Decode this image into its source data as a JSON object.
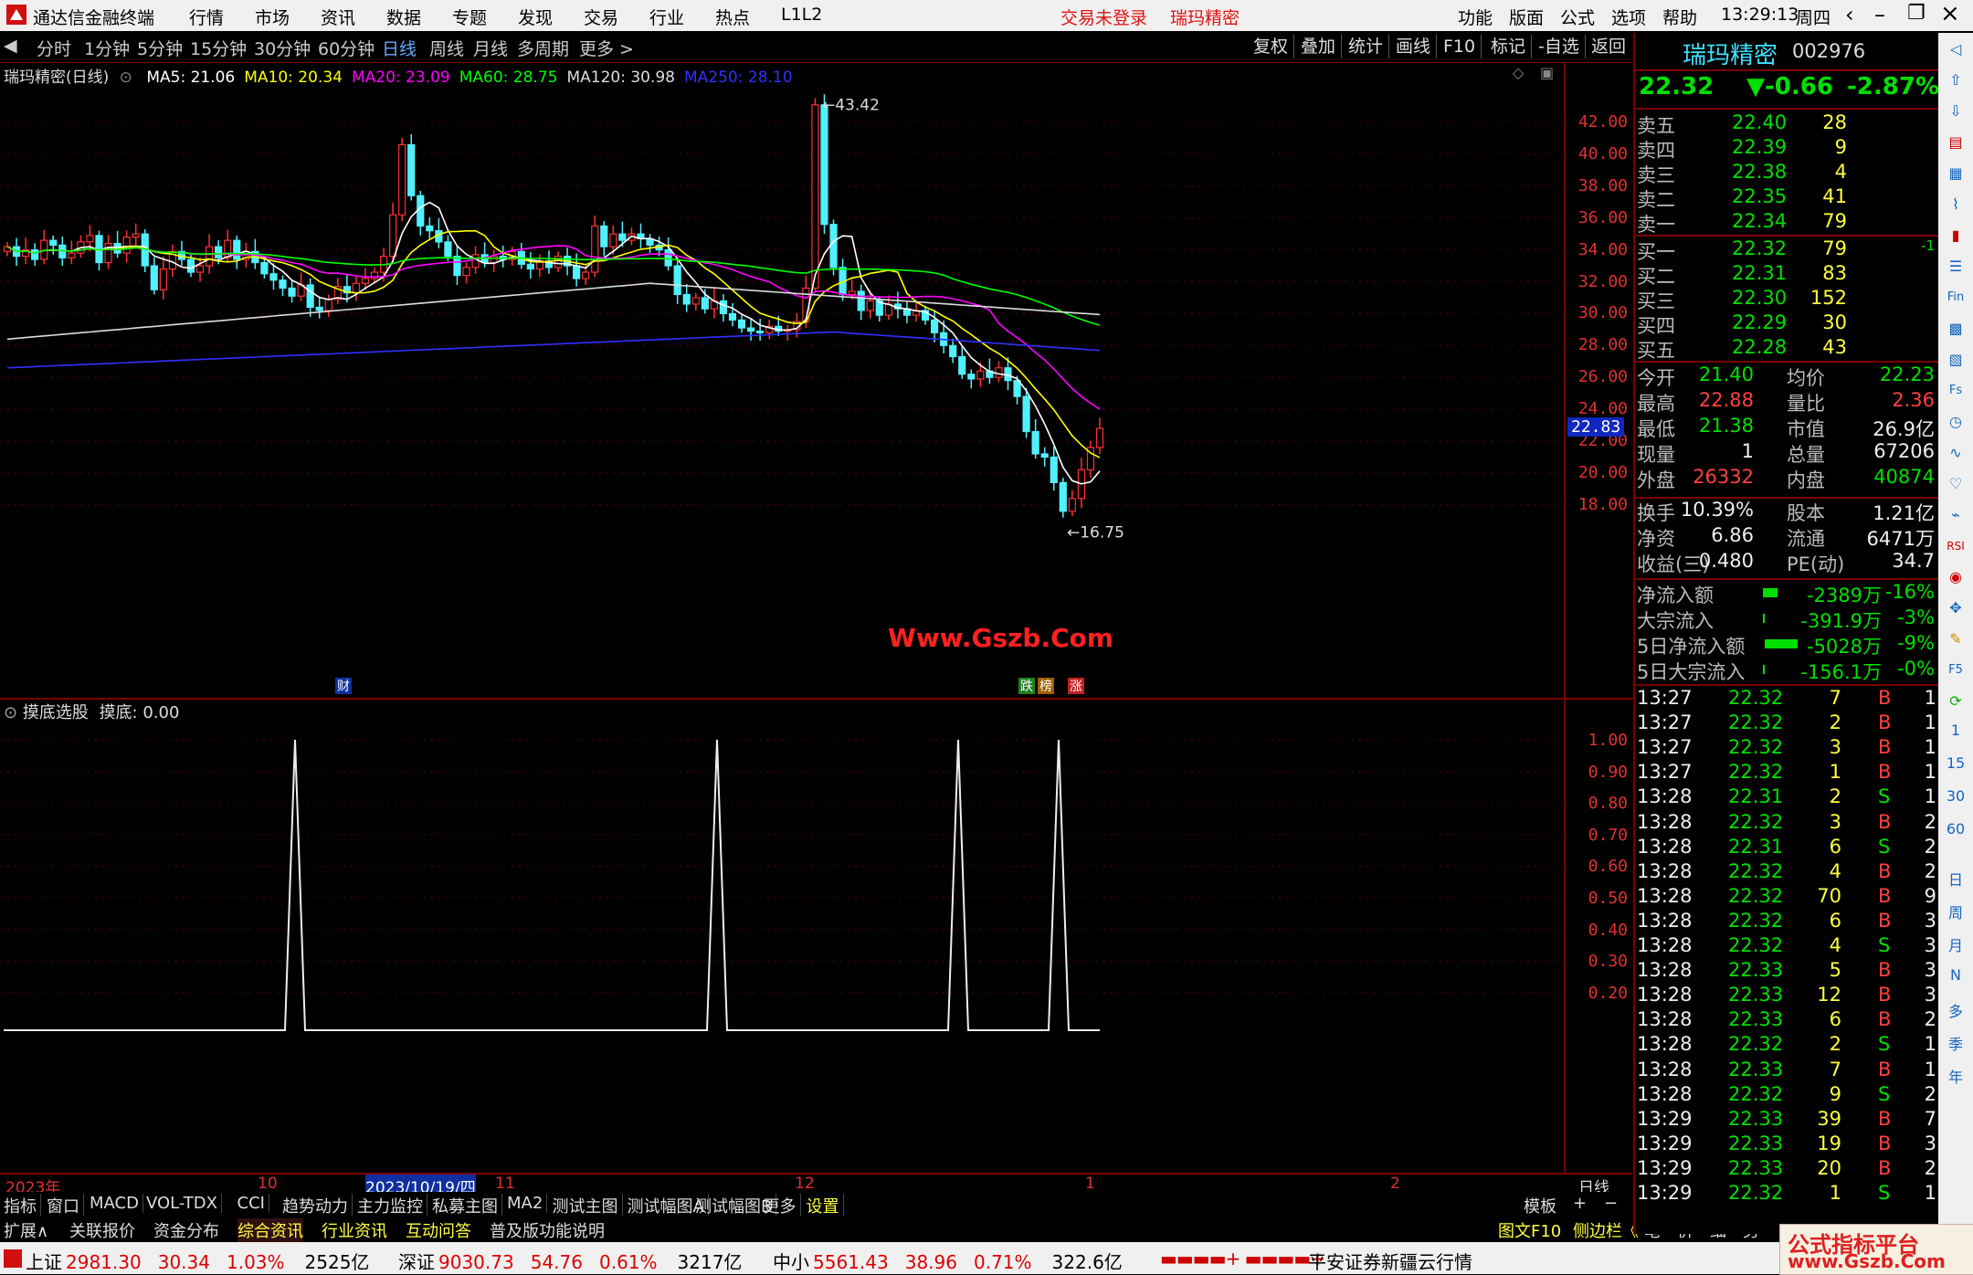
{
  "titlebar": {
    "app_name": "通达信金融终端",
    "menu": [
      "行情",
      "市场",
      "资讯",
      "数据",
      "专题",
      "发现",
      "交易",
      "行业",
      "热点",
      "L1L2"
    ],
    "login_status": "交易未登录",
    "stock_name": "瑞玛精密",
    "right_menu": [
      "功能",
      "版面",
      "公式",
      "选项",
      "帮助"
    ],
    "time": "13:29:13",
    "weekday": "周四"
  },
  "periods": [
    "分时",
    "1分钟",
    "5分钟",
    "15分钟",
    "30分钟",
    "60分钟",
    "日线",
    "周线",
    "月线",
    "多周期",
    "更多 >"
  ],
  "active_period": "日线",
  "chart_tools": [
    "复权",
    "叠加",
    "统计",
    "画线",
    "F10",
    "标记",
    "-自选",
    "返回"
  ],
  "main_chart": {
    "title": "瑞玛精密(日线)",
    "ma_labels": [
      {
        "text": "MA5: 21.06",
        "color": "#ffffff"
      },
      {
        "text": "MA10: 20.34",
        "color": "#ffff00"
      },
      {
        "text": "MA20: 23.09",
        "color": "#ff00ff"
      },
      {
        "text": "MA60: 28.75",
        "color": "#00ff00"
      },
      {
        "text": "MA120: 30.98",
        "color": "#dddddd"
      },
      {
        "text": "MA250: 28.10",
        "color": "#3030ff"
      }
    ],
    "y_ticks": [
      "42.00",
      "40.00",
      "38.00",
      "36.00",
      "34.00",
      "32.00",
      "30.00",
      "28.00",
      "26.00",
      "24.00",
      "22.00",
      "20.00",
      "18.00"
    ],
    "current_price_tag": "22.83",
    "high_label": "43.42",
    "low_label": "16.75",
    "watermark": "Www.Gszb.Com",
    "markers": [
      "财",
      "跌",
      "榜",
      "涨"
    ]
  },
  "indicator": {
    "name": "摸底选股",
    "value_label": "摸底: 0.00",
    "y_ticks": [
      "1.00",
      "0.90",
      "0.80",
      "0.70",
      "0.60",
      "0.50",
      "0.40",
      "0.30",
      "0.20"
    ]
  },
  "x_axis": {
    "labels": [
      "2023年",
      "10",
      "2023/10/19/四",
      "11",
      "12",
      "1",
      "2"
    ],
    "period": "日线"
  },
  "quote": {
    "name": "瑞玛精密",
    "code": "002976",
    "price": "22.32",
    "change": "▼-0.66",
    "pct": "-2.87%",
    "asks": [
      {
        "label": "卖五",
        "price": "22.40",
        "vol": "28"
      },
      {
        "label": "卖四",
        "price": "22.39",
        "vol": "9"
      },
      {
        "label": "卖三",
        "price": "22.38",
        "vol": "4"
      },
      {
        "label": "卖二",
        "price": "22.35",
        "vol": "41"
      },
      {
        "label": "卖一",
        "price": "22.34",
        "vol": "79"
      }
    ],
    "bids": [
      {
        "label": "买一",
        "price": "22.32",
        "vol": "79",
        "extra": "-1"
      },
      {
        "label": "买二",
        "price": "22.31",
        "vol": "83",
        "extra": ""
      },
      {
        "label": "买三",
        "price": "22.30",
        "vol": "152",
        "extra": ""
      },
      {
        "label": "买四",
        "price": "22.29",
        "vol": "30",
        "extra": ""
      },
      {
        "label": "买五",
        "price": "22.28",
        "vol": "43",
        "extra": ""
      }
    ],
    "stats": [
      {
        "l1": "今开",
        "v1": "21.40",
        "l2": "均价",
        "v2": "22.23"
      },
      {
        "l1": "最高",
        "v1": "22.88",
        "l2": "量比",
        "v2": "2.36"
      },
      {
        "l1": "最低",
        "v1": "21.38",
        "l2": "市值",
        "v2": "26.9亿"
      },
      {
        "l1": "现量",
        "v1": "1",
        "l2": "总量",
        "v2": "67206"
      },
      {
        "l1": "外盘",
        "v1": "26332",
        "l2": "内盘",
        "v2": "40874"
      }
    ],
    "stats2": [
      {
        "l1": "换手",
        "v1": "10.39%",
        "l2": "股本",
        "v2": "1.21亿"
      },
      {
        "l1": "净资",
        "v1": "6.86",
        "l2": "流通",
        "v2": "6471万"
      },
      {
        "l1": "收益(三)",
        "v1": "0.480",
        "l2": "PE(动)",
        "v2": "34.7"
      }
    ],
    "flows": [
      {
        "label": "净流入额",
        "value": "-2389万",
        "pct": "-16%"
      },
      {
        "label": "大宗流入",
        "value": "-391.9万",
        "pct": "-3%"
      },
      {
        "label": "5日净流入额",
        "value": "-5028万",
        "pct": "-9%"
      },
      {
        "label": "5日大宗流入",
        "value": "-156.1万",
        "pct": "-0%"
      }
    ],
    "ticks": [
      {
        "t": "13:27",
        "p": "22.32",
        "v": "7",
        "s": "B",
        "n": "1"
      },
      {
        "t": "13:27",
        "p": "22.32",
        "v": "2",
        "s": "B",
        "n": "1"
      },
      {
        "t": "13:27",
        "p": "22.32",
        "v": "3",
        "s": "B",
        "n": "1"
      },
      {
        "t": "13:27",
        "p": "22.32",
        "v": "1",
        "s": "B",
        "n": "1"
      },
      {
        "t": "13:28",
        "p": "22.31",
        "v": "2",
        "s": "S",
        "n": "1"
      },
      {
        "t": "13:28",
        "p": "22.32",
        "v": "3",
        "s": "B",
        "n": "2"
      },
      {
        "t": "13:28",
        "p": "22.31",
        "v": "6",
        "s": "S",
        "n": "2"
      },
      {
        "t": "13:28",
        "p": "22.32",
        "v": "4",
        "s": "B",
        "n": "2"
      },
      {
        "t": "13:28",
        "p": "22.32",
        "v": "70",
        "s": "B",
        "n": "9"
      },
      {
        "t": "13:28",
        "p": "22.32",
        "v": "6",
        "s": "B",
        "n": "3"
      },
      {
        "t": "13:28",
        "p": "22.32",
        "v": "4",
        "s": "S",
        "n": "3"
      },
      {
        "t": "13:28",
        "p": "22.33",
        "v": "5",
        "s": "B",
        "n": "3"
      },
      {
        "t": "13:28",
        "p": "22.33",
        "v": "12",
        "s": "B",
        "n": "3"
      },
      {
        "t": "13:28",
        "p": "22.33",
        "v": "6",
        "s": "B",
        "n": "2"
      },
      {
        "t": "13:28",
        "p": "22.32",
        "v": "2",
        "s": "S",
        "n": "1"
      },
      {
        "t": "13:28",
        "p": "22.33",
        "v": "7",
        "s": "B",
        "n": "1"
      },
      {
        "t": "13:28",
        "p": "22.32",
        "v": "9",
        "s": "S",
        "n": "2"
      },
      {
        "t": "13:29",
        "p": "22.33",
        "v": "39",
        "s": "B",
        "n": "7"
      },
      {
        "t": "13:29",
        "p": "22.33",
        "v": "19",
        "s": "B",
        "n": "3"
      },
      {
        "t": "13:29",
        "p": "22.33",
        "v": "20",
        "s": "B",
        "n": "2"
      },
      {
        "t": "13:29",
        "p": "22.32",
        "v": "1",
        "s": "S",
        "n": "1"
      }
    ]
  },
  "sidebar_icons": [
    "1",
    "15",
    "30",
    "60",
    "日",
    "周",
    "月",
    "N",
    "多",
    "季",
    "年"
  ],
  "bottom_tabs": [
    "指标",
    "窗口",
    "MACD",
    "VOL-TDX",
    "CCI",
    "趋势动力",
    "主力监控",
    "私募主图",
    "MA2",
    "测试主图",
    "测试幅图A",
    "测试幅图B",
    "更多",
    "设置"
  ],
  "bottom_right": [
    "模板",
    "+",
    "−"
  ],
  "bottom_tabs2": [
    "扩展∧",
    "关联报价",
    "资金分布",
    "综合资讯",
    "行业资讯",
    "互动问答",
    "普及版功能说明"
  ],
  "bottom_tabs2_right": [
    "图文F10",
    "侧边栏《",
    "笔",
    "价",
    "细",
    "势"
  ],
  "status": {
    "indices": [
      {
        "name": "上证",
        "value": "2981.30",
        "chg": "30.34",
        "pct": "1.03%",
        "amt": "2525亿"
      },
      {
        "name": "深证",
        "value": "9030.73",
        "chg": "54.76",
        "pct": "0.61%",
        "amt": "3217亿"
      },
      {
        "name": "中小",
        "value": "5561.43",
        "chg": "38.96",
        "pct": "0.71%",
        "amt": "322.6亿"
      }
    ],
    "broker": "平安证券新疆云行情",
    "logo": "公式指标平台 www.Gszb.Com"
  },
  "colors": {
    "up": "#ff3030",
    "down": "#40e0ff",
    "ma5": "#ffffff",
    "ma10": "#ffff00",
    "ma20": "#ff00ff",
    "ma60": "#00ff00",
    "ma120": "#dddddd",
    "ma250": "#3030ff"
  }
}
